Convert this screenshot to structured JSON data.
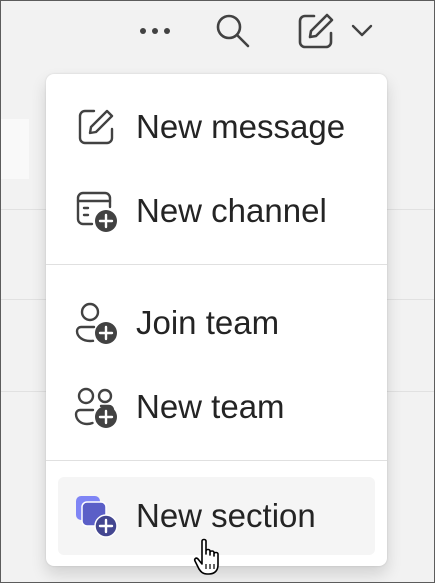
{
  "toolbar": {
    "more_icon": "more-horizontal-icon",
    "search_icon": "search-icon",
    "compose_icon": "compose-icon",
    "chevron_icon": "chevron-down-icon"
  },
  "menu": {
    "items": [
      {
        "label": "New message",
        "icon": "compose-icon"
      },
      {
        "label": "New channel",
        "icon": "channel-add-icon"
      },
      {
        "label": "Join team",
        "icon": "person-add-icon"
      },
      {
        "label": "New team",
        "icon": "people-add-icon"
      },
      {
        "label": "New section",
        "icon": "section-add-icon",
        "hovered": true
      }
    ]
  },
  "colors": {
    "icon": "#424242",
    "text": "#242424",
    "accent": "#5b5fc7",
    "hover_bg": "#f5f5f5"
  }
}
